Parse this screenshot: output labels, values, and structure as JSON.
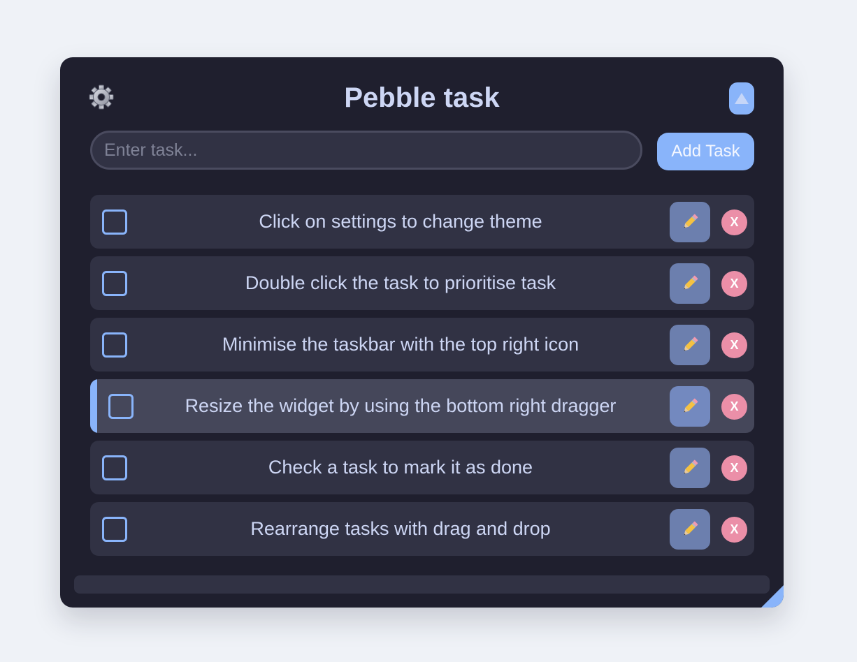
{
  "header": {
    "title": "Pebble task",
    "settings_icon": "gear-icon",
    "minimize_icon": "triangle-up-icon"
  },
  "input": {
    "placeholder": "Enter task...",
    "value": ""
  },
  "add_button": {
    "label": "Add Task"
  },
  "tasks": [
    {
      "text": "Click on settings to change theme",
      "checked": false,
      "highlighted": false,
      "edit_icon": "pencil-icon",
      "delete_label": "X"
    },
    {
      "text": "Double click the task to prioritise task",
      "checked": false,
      "highlighted": false,
      "edit_icon": "pencil-icon",
      "delete_label": "X"
    },
    {
      "text": "Minimise the taskbar with the top right icon",
      "checked": false,
      "highlighted": false,
      "edit_icon": "pencil-icon",
      "delete_label": "X"
    },
    {
      "text": "Resize the widget by using the bottom right dragger",
      "checked": false,
      "highlighted": true,
      "edit_icon": "pencil-icon",
      "delete_label": "X"
    },
    {
      "text": "Check a task to mark it as done",
      "checked": false,
      "highlighted": false,
      "edit_icon": "pencil-icon",
      "delete_label": "X"
    },
    {
      "text": "Rearrange tasks with drag and drop",
      "checked": false,
      "highlighted": false,
      "edit_icon": "pencil-icon",
      "delete_label": "X"
    }
  ],
  "colors": {
    "background": "#eff2f7",
    "panel": "#1f1f2e",
    "row": "#313244",
    "row_highlighted": "#45475a",
    "accent": "#89b4fa",
    "text": "#cdd6f4",
    "edit_button": "#6c7fae",
    "delete_button": "#eb8fa8"
  }
}
